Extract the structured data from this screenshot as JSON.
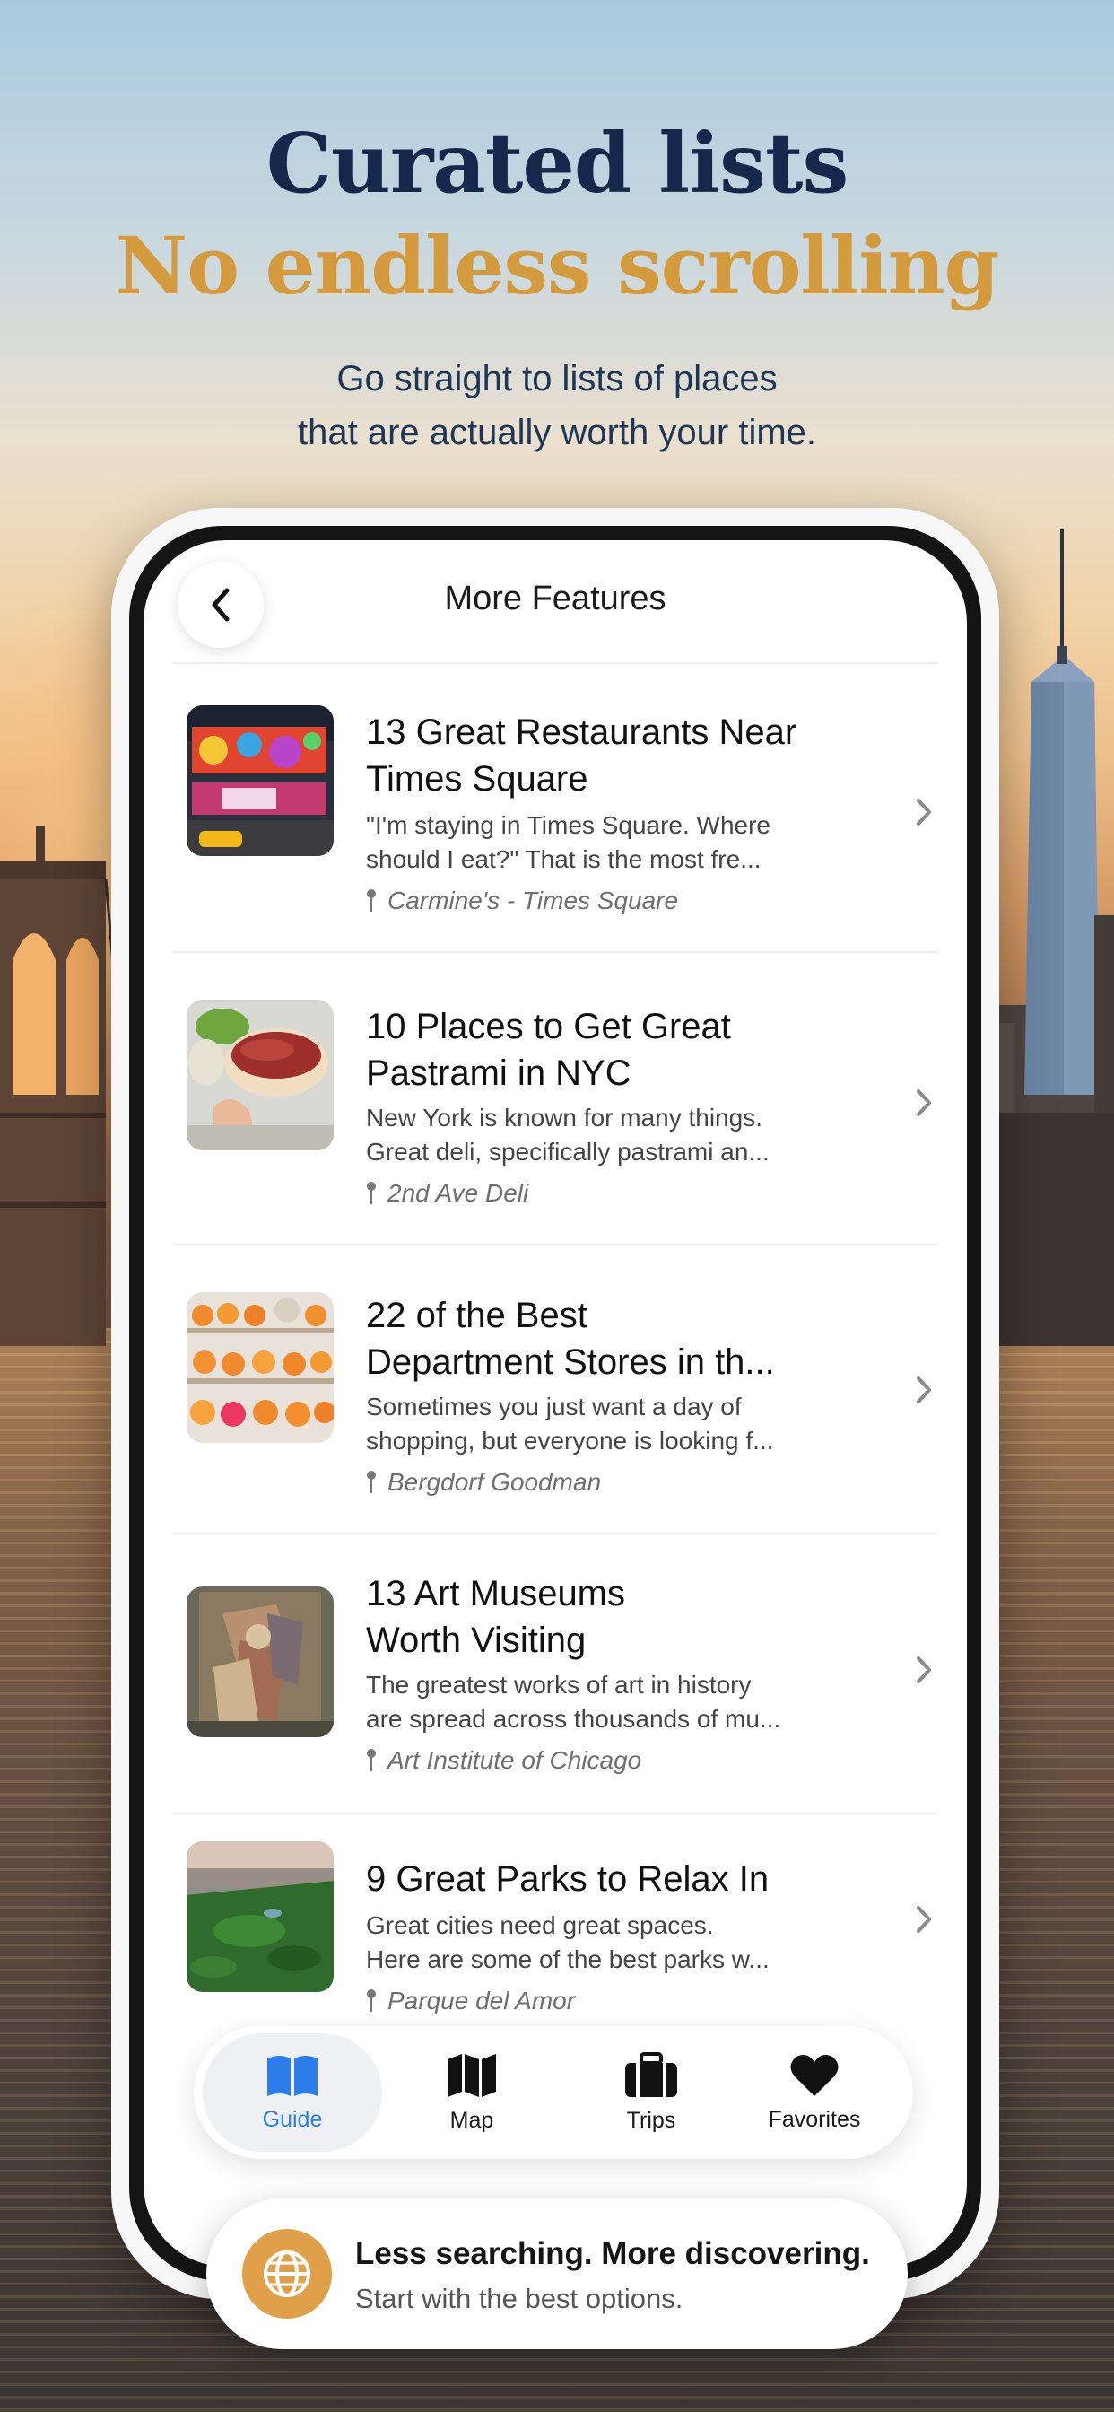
{
  "hero": {
    "headline_line1": "Curated lists",
    "headline_line2": "No endless scrolling",
    "subheadline_line1": "Go straight to lists of places",
    "subheadline_line2": "that are actually worth your time."
  },
  "colors": {
    "headline_navy": "#13284a",
    "headline_gold": "#d49a3e",
    "active_tab_blue": "#2b7de9",
    "banner_icon_gold": "#e0a04a"
  },
  "screen": {
    "title": "More Features",
    "back_icon": "chevron-left-icon"
  },
  "lists": [
    {
      "title_line1": "13 Great Restaurants Near",
      "title_line2": "Times Square",
      "desc_line1": "\"I'm staying in Times Square.  Where",
      "desc_line2": "should I eat?\"  That is the most fre...",
      "place": "Carmine's - Times Square",
      "thumb": "times-square-photo"
    },
    {
      "title_line1": "10 Places to Get Great",
      "title_line2": "Pastrami in NYC",
      "desc_line1": "New York is known for many things.",
      "desc_line2": "Great deli, specifically pastrami an...",
      "place": "2nd Ave Deli",
      "thumb": "pastrami-sandwich-photo"
    },
    {
      "title_line1": "22 of the Best",
      "title_line2": "Department Stores in th...",
      "desc_line1": "Sometimes you just want a day of",
      "desc_line2": "shopping, but everyone is looking f...",
      "place": "Bergdorf Goodman",
      "thumb": "store-display-photo"
    },
    {
      "title_line1": "13 Art Museums",
      "title_line2": "Worth Visiting",
      "desc_line1": "The greatest works of art in history",
      "desc_line2": "are spread across thousands of mu...",
      "place": "Art Institute of Chicago",
      "thumb": "cubist-painting-photo"
    },
    {
      "title_line1": "9 Great Parks to Relax In",
      "title_line2": "",
      "desc_line1": "Great cities need great spaces.",
      "desc_line2": "Here are some of the best parks w...",
      "place": "Parque del Amor",
      "thumb": "city-park-aerial-photo"
    }
  ],
  "tabs": [
    {
      "label": "Guide",
      "icon": "book-icon",
      "active": true
    },
    {
      "label": "Map",
      "icon": "map-icon",
      "active": false
    },
    {
      "label": "Trips",
      "icon": "suitcase-icon",
      "active": false
    },
    {
      "label": "Favorites",
      "icon": "heart-icon",
      "active": false
    }
  ],
  "banner": {
    "title": "Less searching. More discovering.",
    "subtitle": "Start with the best options.",
    "icon": "globe-icon"
  }
}
